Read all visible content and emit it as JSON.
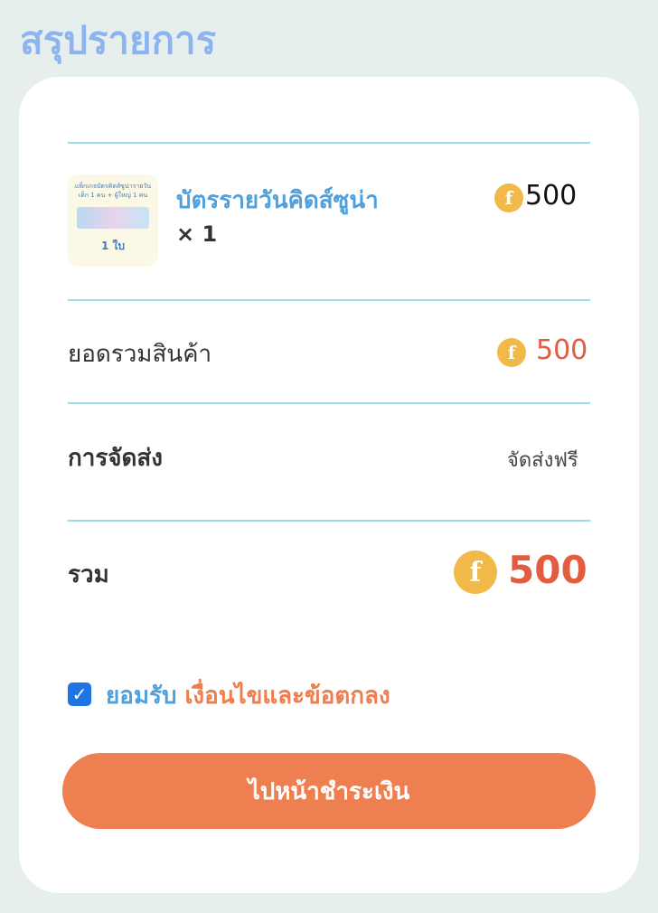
{
  "header": {
    "title": "สรุปรายการ"
  },
  "order": {
    "product": {
      "thumbnail_title": "แพ็กเกจบัตรคิดส์ซูน่ารายวัน เด็ก 1 คน + ผู้ใหญ่ 1 คน",
      "thumbnail_count": "1 ใบ",
      "name": "บัตรรายวันคิดส์ซูน่า",
      "quantity": "× 1",
      "price": "500"
    },
    "subtotal": {
      "label": "ยอดรวมสินค้า",
      "value": "500"
    },
    "shipping": {
      "label": "การจัดส่ง",
      "value": "จัดส่งฟรี"
    },
    "total": {
      "label": "รวม",
      "value": "500"
    },
    "coin_symbol": "f",
    "coin_icon": "coin-icon"
  },
  "terms": {
    "checked": true,
    "prefix": "ยอมรับ",
    "link_text": "เงื่อนไขและข้อตกลง"
  },
  "checkout": {
    "button_label": "ไปหน้าชำระเงิน"
  },
  "colors": {
    "title": "#8cb5f0",
    "accent_blue": "#4ea1de",
    "accent_orange": "#ef7e4f",
    "price_red": "#e25c40",
    "coin": "#f1b84a",
    "divider": "#9edce0",
    "checkbox": "#1f74e4"
  }
}
